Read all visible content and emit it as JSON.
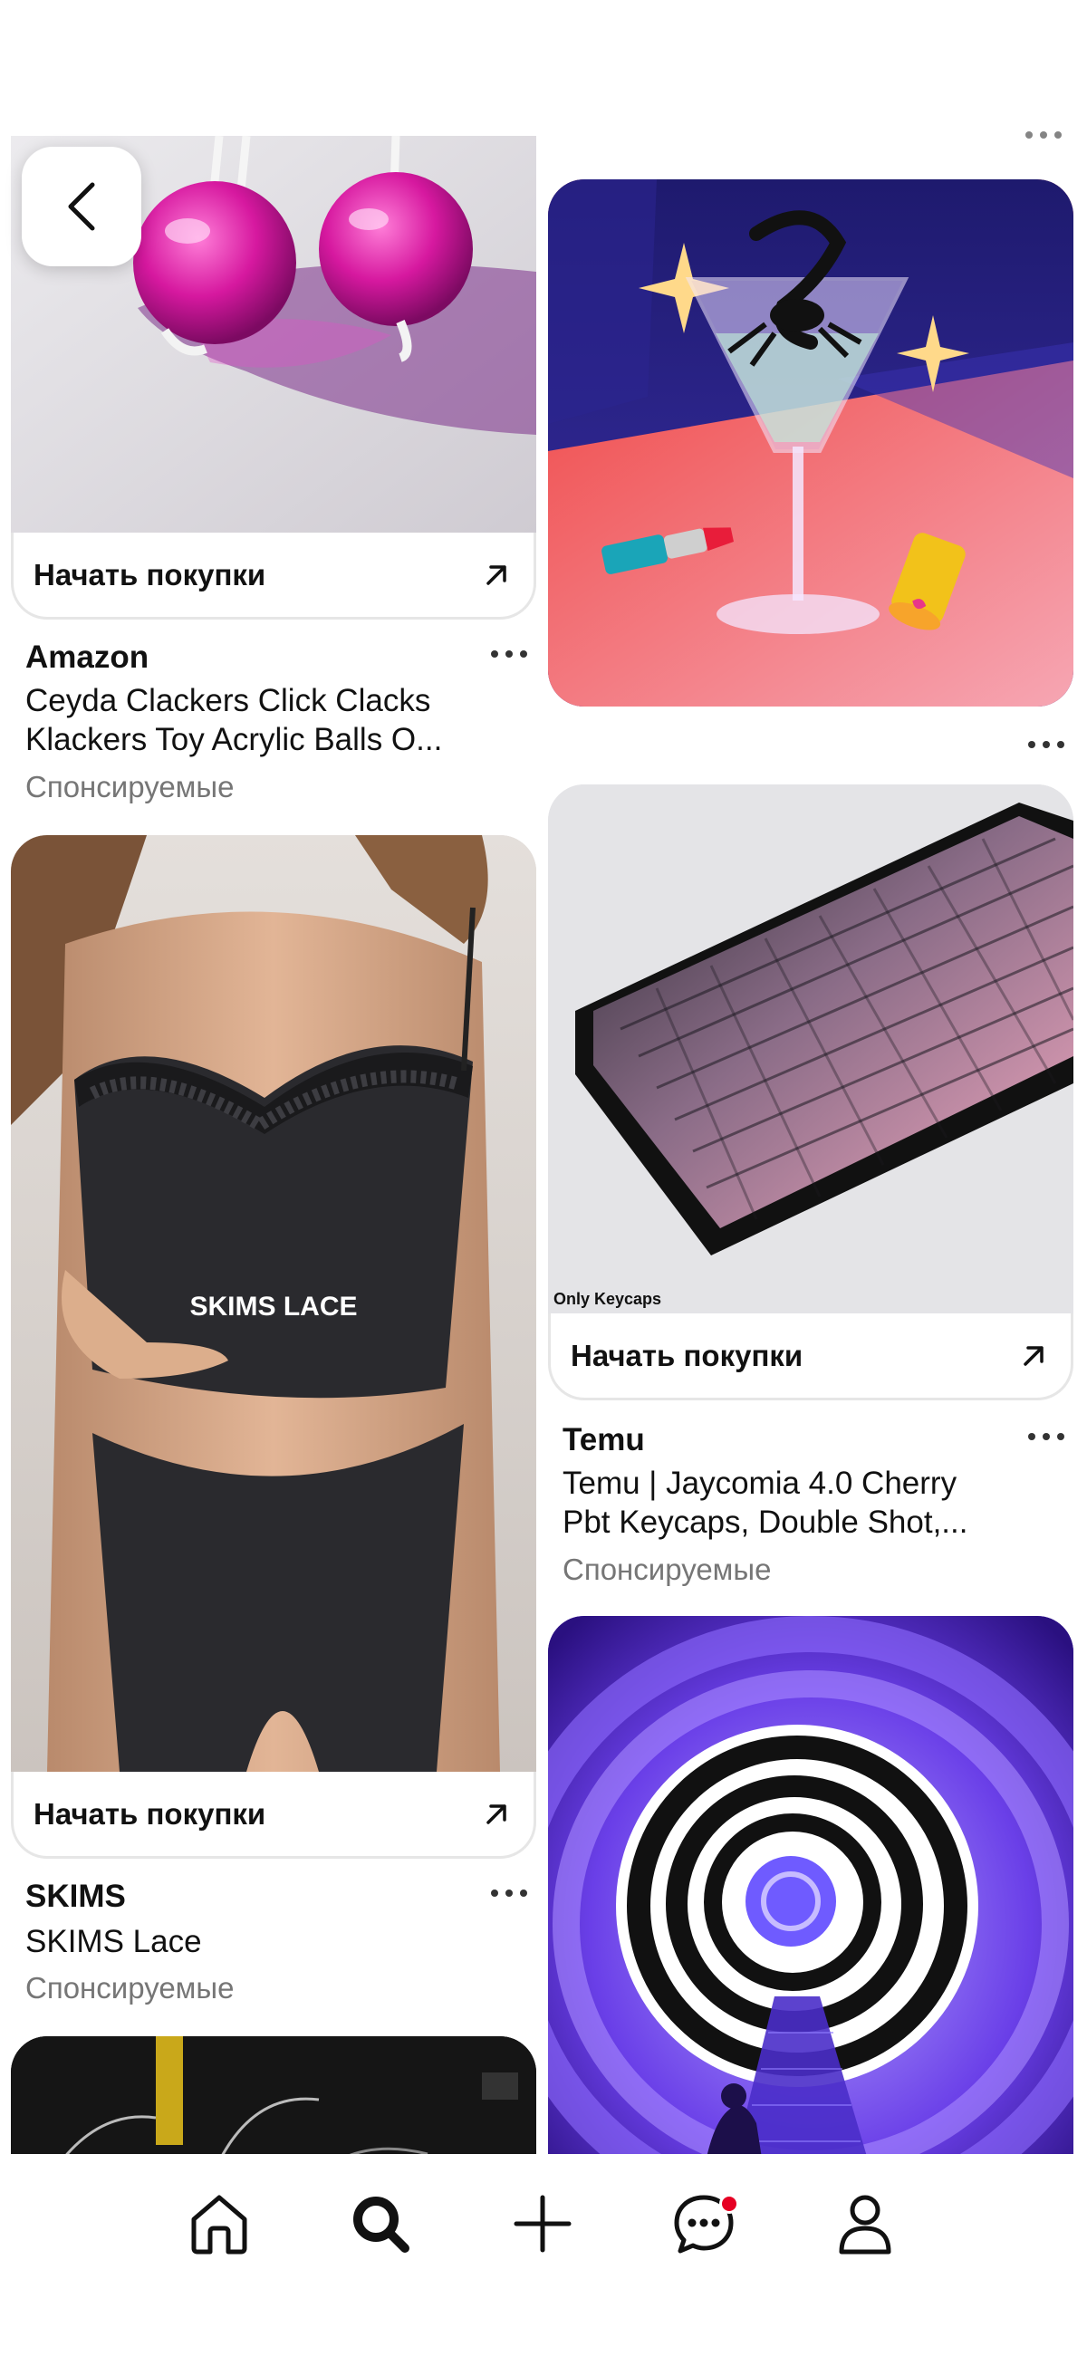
{
  "pins": [
    {
      "shop_label": "Начать покупки",
      "brand": "Amazon",
      "desc_line1": "Ceyda Clackers Click Clacks",
      "desc_line2": "Klackers Toy Acrylic Balls O...",
      "sponsored": "Спонсируемые",
      "image": "pink-acrylic-clacker-balls"
    },
    {
      "image": "scorpion-martini-lipstick-illustration"
    },
    {
      "shop_label": "Начать покупки",
      "brand": "Temu",
      "desc_line1": "Temu | Jaycomia 4.0 Cherry",
      "desc_line2": "Pbt Keycaps, Double Shot,...",
      "sponsored": "Спонсируемые",
      "image_caption": "Only Keycaps",
      "image": "pink-purple-keyboard"
    },
    {
      "shop_label": "Начать покупки",
      "brand": "SKIMS",
      "desc_line1": "SKIMS Lace",
      "sponsored": "Спонсируемые",
      "image_caption": "SKIMS LACE",
      "image": "lace-cami-set"
    },
    {
      "image": "purple-hypnotic-spiral-tunnel"
    },
    {
      "image": "dark-interior-lamps"
    }
  ],
  "nav": {
    "items": [
      "home-icon",
      "search-icon",
      "plus-icon",
      "messages-icon",
      "profile-icon"
    ],
    "active": "search-icon",
    "notification_color": "#e60023"
  },
  "colors": {
    "text_primary": "#111111",
    "text_secondary": "#767676",
    "accent": "#e60023"
  }
}
